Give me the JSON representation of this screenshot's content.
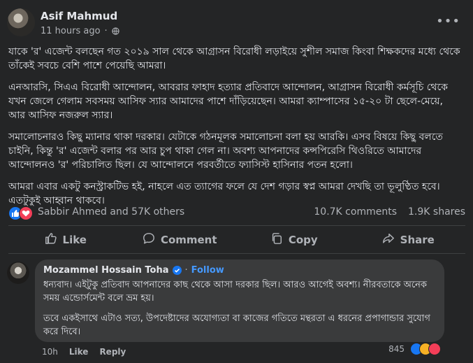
{
  "post": {
    "author": "Asif Mahmud",
    "time": "11 hours ago",
    "dot": "·",
    "paragraphs": [
      "যাকে 'র' এজেন্ট বলছেন গত ২০১৯ সাল থেকে আগ্রাসন বিরোধী লড়াইয়ে সুশীল সমাজ কিংবা শিক্ষকদের মধ্যে থেকে তাঁকেই সবচে বেশি পাশে পেয়েছি আমরা।",
      "এনআরসি, সিএএ বিরোধী আন্দোলন, আবরার ফাহাদ হত্যার প্রতিবাদে আন্দোলন, আগ্রাসন বিরোধী কর্মসূচি থেকে যখন জেলে গেলাম সবসময় আসিফ স্যার আমাদের পাশে দাঁড়িয়েছেন। আমরা ক্যাম্পাসের ১৫-২০ টা ছেলে-মেয়ে, আর আসিফ নজরুল স্যার।",
      "সমালোচনারও কিছু ম্যানার থাকা দরকার। যেটাকে গঠনমূলক সমালোচনা বলা হয় আরকি। এসব বিষয়ে কিছু বলতে চাইনি, কিন্তু 'র' এজেন্ট বলার পর আর চুপ থাকা গেল না। অবশ্য আপনাদের কন্সপিরেসি থিওরিতে আমাদের আন্দোলনও 'র' পরিচালিত ছিল। যে আন্দোলনে পরবর্তীতে ফ্যাসিস্ট হাসিনার পতন হলো।",
      "আমরা এবার একটু কনস্ট্রাকটিভ হই, নাহলে এত ত্যাগের ফলে যে দেশ গড়ার স্বপ্ন আমরা দেখছি তা ভূলুণ্ঠিত হবে। এতটুকুই আহ্বান থাকবে।"
    ],
    "reactions_names": "Sabbir Ahmed and 57K others",
    "comments_count": "10.7K comments",
    "shares_count": "1.9K shares"
  },
  "actions": {
    "like": "Like",
    "comment": "Comment",
    "copy": "Copy",
    "share": "Share"
  },
  "comment": {
    "author": "Mozammel Hossain Toha",
    "follow_dot": "·",
    "follow": "Follow",
    "paragraphs": [
      "ধন্যবাদ। এইটুকু প্রতিবাদ আপনাদের কাছ থেকে আসা দরকার ছিল। আরও আগেই অবশ্য। নীরবতাকে অনেক সময় এন্ডোর্সমেন্ট বলে ভ্রম হয়।",
      "তবে একইসাথে এটাও সত্য, উপদেষ্টাদের অযোগ্যতা বা কাজের গতিতে মন্থরতা এ ধরনের প্রপাগান্ডার সুযোগ করে দিবে।"
    ],
    "time": "10h",
    "like": "Like",
    "reply": "Reply",
    "reaction_count": "845"
  },
  "colors": {
    "like": "#1877f2",
    "love": "#f33e58",
    "haha": "#f7b125",
    "link": "#4599ff"
  },
  "icons": [
    "globe-icon",
    "more-icon",
    "like-icon",
    "comment-icon",
    "copy-icon",
    "share-icon",
    "verified-icon",
    "love-icon",
    "haha-icon"
  ]
}
